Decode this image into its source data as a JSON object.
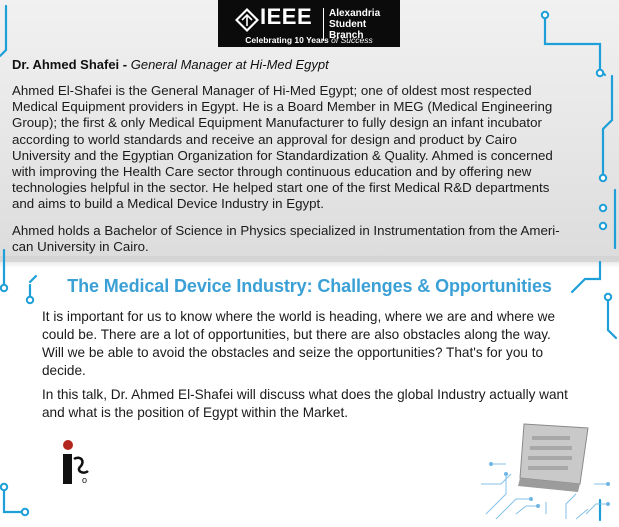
{
  "header": {
    "logo_word": "IEEE",
    "branch_line1": "Alexandria",
    "branch_line2": "Student Branch",
    "celebrating_prefix": "Celebrating 10 Years",
    "celebrating_suffix": "of Success"
  },
  "speaker": {
    "name": "Dr. Ahmed Shafei -",
    "role": "General Manager at Hi-Med Egypt"
  },
  "bio": {
    "paragraph1_lines": [
      "Ahmed El-Shafei is the General Manager of Hi-Med Egypt; one of oldest most respected",
      "Medical Equipment providers in Egypt. He is a Board Member in MEG (Medical Engineering",
      "Group); the first & only Medical Equipment Manufacturer to fully design an infant incubator",
      "according to world standards and receive an approval for design and product by Cairo",
      "University and the Egyptian Organization for Standardization & Quality. Ahmed is concerned",
      "with improving the Health Care sector through continuous education and by offering new",
      "technologies helpful in the sector. He helped start one of the first Medical R&D departments",
      "and aims to build a Medical Device Industry in Egypt."
    ],
    "paragraph2_lines": [
      "Ahmed holds a Bachelor of Science in Physics specialized in Instrumentation from the Ameri-",
      "can University in Cairo."
    ]
  },
  "talk": {
    "title": "The Medical Device Industry: Challenges & Opportunities",
    "paragraph1_lines": [
      "It is important for us to know where the world is heading, where we are and where we",
      "could be. There are a lot of opportunities, but there are also obstacles along the way.",
      "Will we be able to avoid the obstacles and seize the opportunities? That's for you to",
      "decide."
    ],
    "paragraph2_lines": [
      "In this talk, Dr. Ahmed El-Shafei will discuss what does the global Industry actually want",
      "and what is the position of Egypt within the Market."
    ]
  },
  "colors": {
    "accent_blue": "#3aa0d6",
    "header_black": "#0b0b0b",
    "circuit_blue": "#1e9fd8"
  },
  "icons": [
    "ieee-logo-icon",
    "circuit-trace-icon",
    "event-logo-icon",
    "chip-graphic-icon"
  ]
}
